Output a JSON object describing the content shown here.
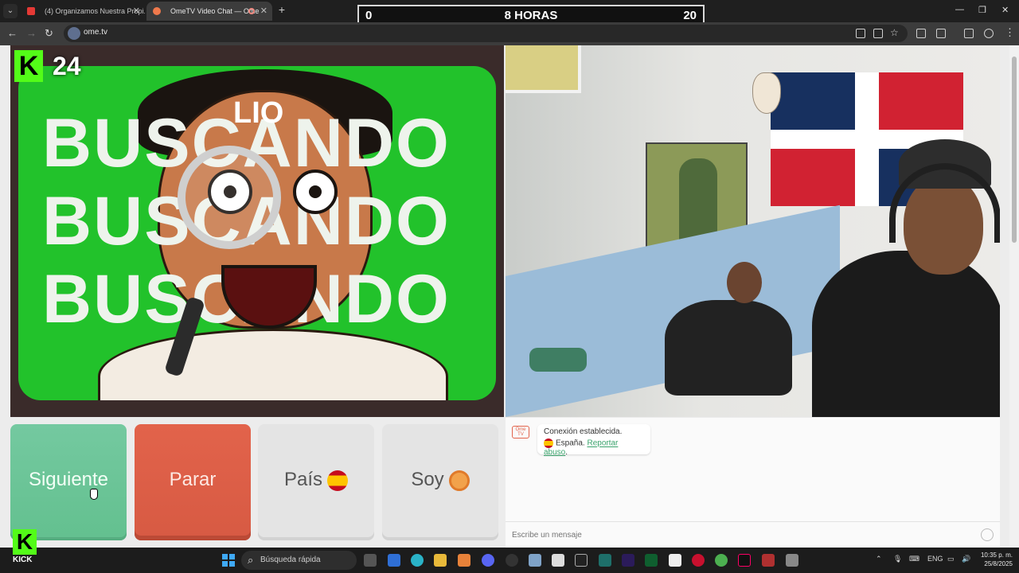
{
  "browser": {
    "tabs": [
      {
        "title": "(4) Organizamos Nuestra Propi..."
      },
      {
        "title": "OmeTV Video Chat — Ome"
      }
    ],
    "url": "ome.tv"
  },
  "overlay": {
    "score_left": "0",
    "score_center": "8 HORAS",
    "score_right": "20"
  },
  "stream": {
    "kick_number": "24",
    "thumbnail_lines": [
      "BUSCANDO",
      "BUSCANDO",
      "BUSCANDO"
    ],
    "thumbnail_name": "LIO",
    "kick_label": "KICK"
  },
  "controls": {
    "next_label": "Siguiente",
    "stop_label": "Parar",
    "country_label": "País",
    "gender_label": "Soy"
  },
  "chat": {
    "logo_text": "Ome TV",
    "status": "Conexión establecida.",
    "country": "España.",
    "report_link": "Reportar abuso",
    "report_suffix": ".",
    "input_placeholder": "Escribe un mensaje"
  },
  "taskbar": {
    "search_placeholder": "Búsqueda rápida",
    "language": "ENG",
    "time": "10:35 p. m.",
    "date": "25/8/2025"
  },
  "colors": {
    "next": "#63c08f",
    "stop": "#d75a43",
    "kick_green": "#53fc18",
    "thumbnail_green": "#22c22b"
  }
}
